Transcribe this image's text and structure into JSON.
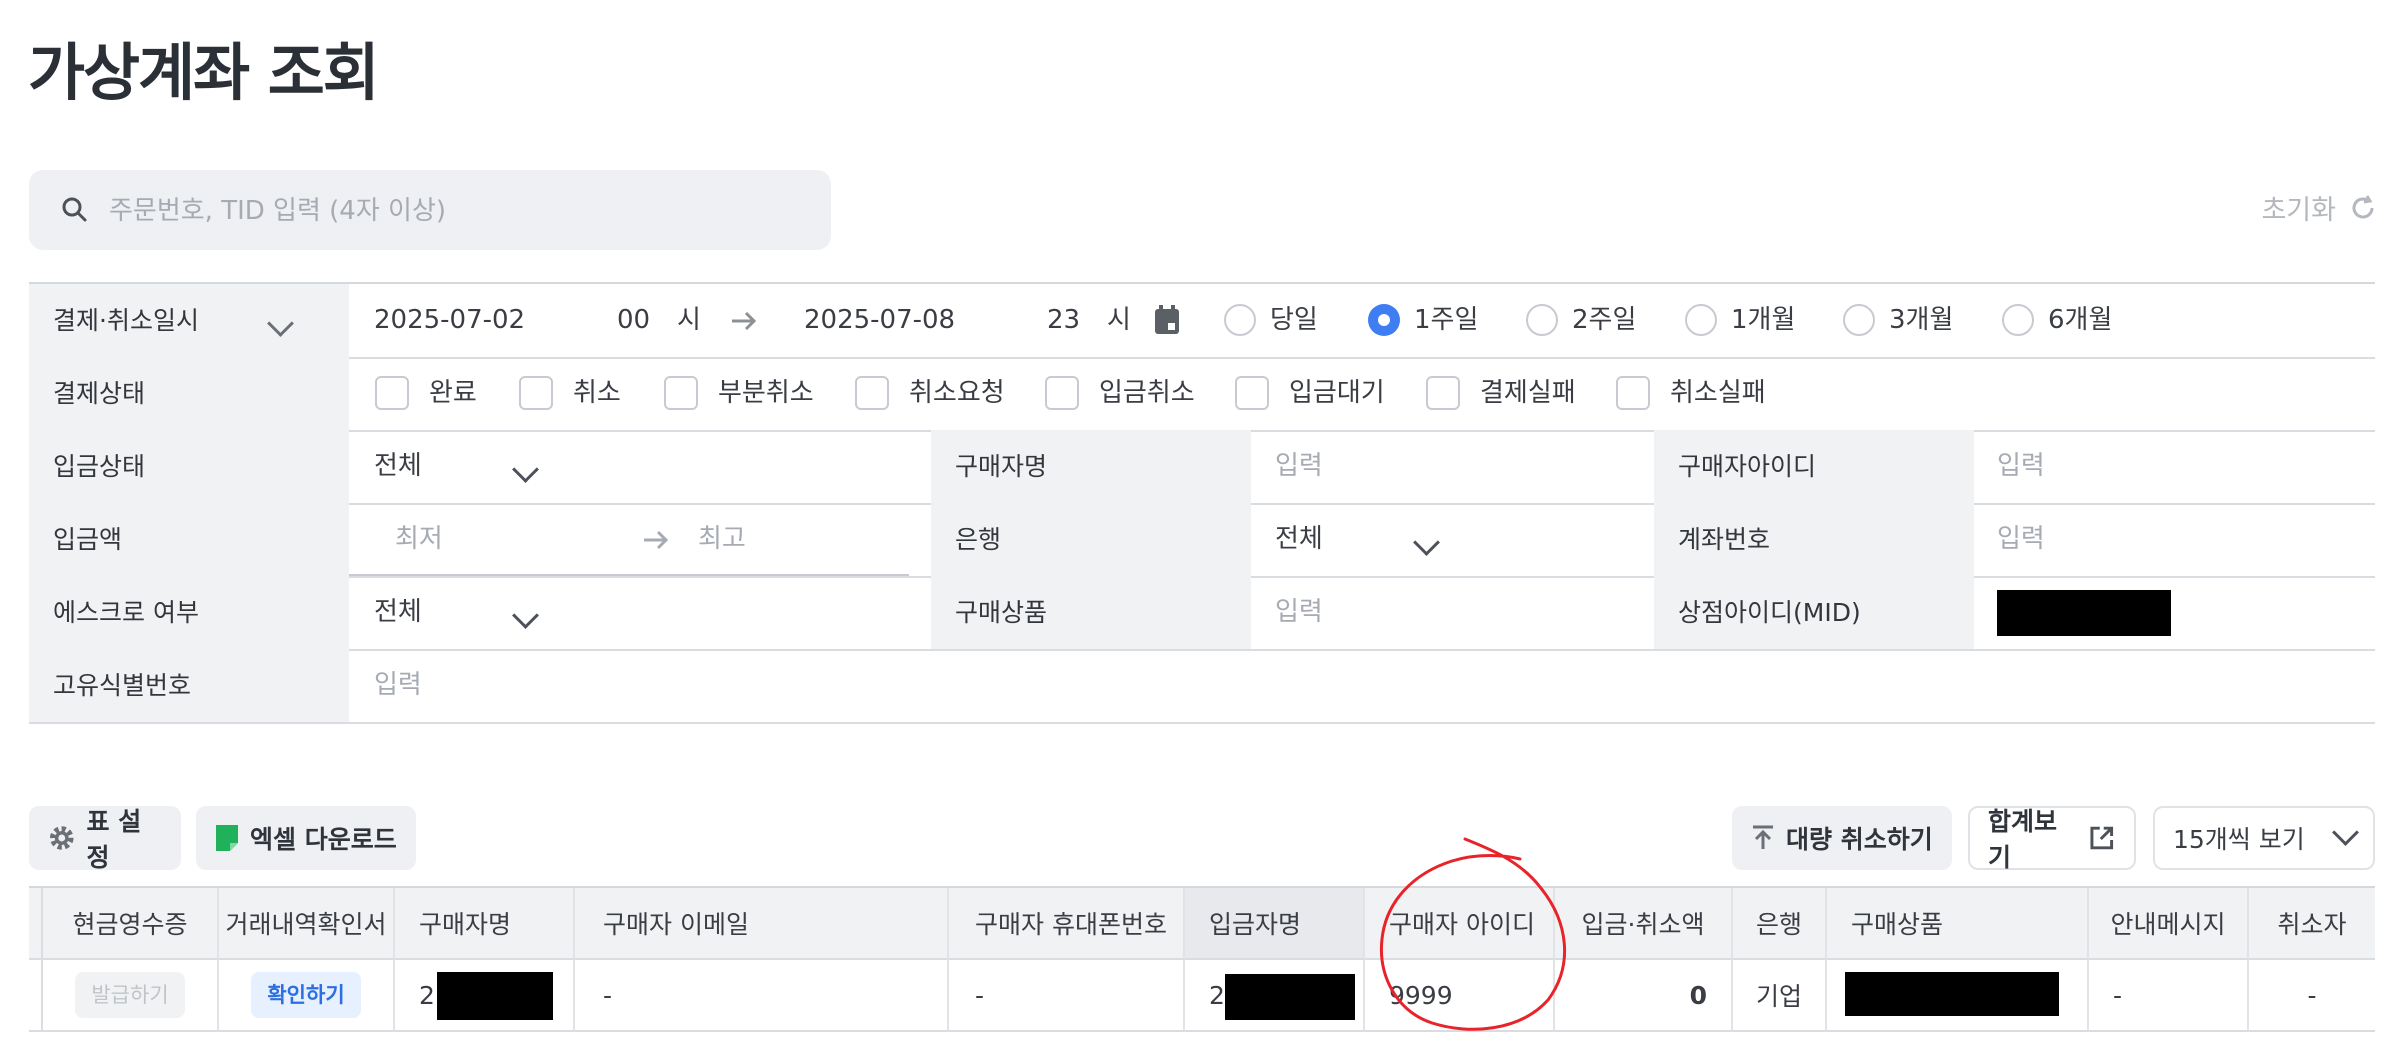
{
  "page": {
    "title": "가상계좌 조회"
  },
  "search": {
    "placeholder": "주문번호, TID 입력 (4자 이상)",
    "reset_label": "초기화"
  },
  "filters": {
    "date": {
      "label": "결제·취소일시",
      "start_date": "2025-07-02",
      "start_hour": "00",
      "end_date": "2025-07-08",
      "end_hour": "23",
      "hour_unit": "시",
      "ranges": [
        {
          "label": "당일",
          "selected": false
        },
        {
          "label": "1주일",
          "selected": true
        },
        {
          "label": "2주일",
          "selected": false
        },
        {
          "label": "1개월",
          "selected": false
        },
        {
          "label": "3개월",
          "selected": false
        },
        {
          "label": "6개월",
          "selected": false
        }
      ]
    },
    "status": {
      "label": "결제상태",
      "options": [
        "완료",
        "취소",
        "부분취소",
        "취소요청",
        "입금취소",
        "입금대기",
        "결제실패",
        "취소실패"
      ]
    },
    "deposit_status": {
      "label": "입금상태",
      "value": "전체"
    },
    "buyer_name": {
      "label": "구매자명",
      "placeholder": "입력"
    },
    "buyer_id": {
      "label": "구매자아이디",
      "placeholder": "입력"
    },
    "amount": {
      "label": "입금액",
      "min_placeholder": "최저",
      "max_placeholder": "최고"
    },
    "bank": {
      "label": "은행",
      "value": "전체"
    },
    "account": {
      "label": "계좌번호",
      "placeholder": "입력"
    },
    "escrow": {
      "label": "에스크로 여부",
      "value": "전체"
    },
    "product": {
      "label": "구매상품",
      "placeholder": "입력"
    },
    "mid": {
      "label": "상점아이디(MID)"
    },
    "unique_id": {
      "label": "고유식별번호",
      "placeholder": "입력"
    }
  },
  "toolbar": {
    "table_settings": "표 설정",
    "excel_download": "엑셀 다운로드",
    "bulk_cancel": "대량 취소하기",
    "summary": "합계보기",
    "page_size": "15개씩 보기"
  },
  "table": {
    "columns": [
      "현금영수증",
      "거래내역확인서",
      "구매자명",
      "구매자 이메일",
      "구매자 휴대폰번호",
      "입금자명",
      "구매자 아이디",
      "입금·취소액",
      "은행",
      "구매상품",
      "안내메시지",
      "취소자"
    ],
    "rows": [
      {
        "receipt_btn": "발급하기",
        "confirm_btn": "확인하기",
        "buyer_name": "2",
        "email": "-",
        "phone": "-",
        "depositor": "2",
        "buyer_id": "9999",
        "amount": "0",
        "bank": "기업",
        "message": "-",
        "canceller": "-"
      }
    ]
  },
  "colors": {
    "accent": "#3f7df2",
    "highlight_circle": "#e8232a",
    "excel_green": "#1fb25a"
  },
  "icons": [
    "search-icon",
    "refresh-icon",
    "arrow-right-icon",
    "calendar-icon",
    "chevron-down-icon",
    "gear-icon",
    "excel-icon",
    "upload-icon",
    "external-link-icon"
  ]
}
